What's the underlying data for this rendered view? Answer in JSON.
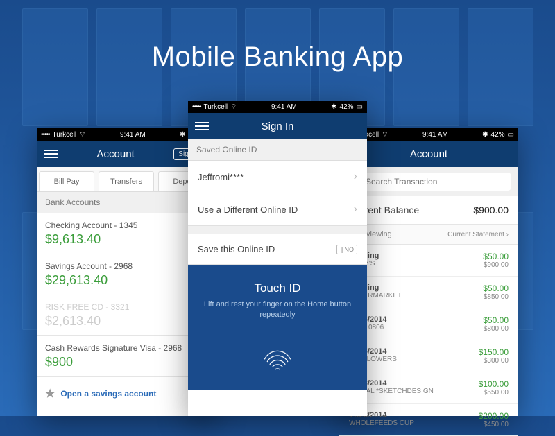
{
  "hero": {
    "title": "Mobile Banking App"
  },
  "status": {
    "carrier": "Turkcell",
    "time": "9:41 AM",
    "battery": "42%"
  },
  "navs": {
    "account": "Account",
    "signin": "Sign In",
    "signout": "Sign out"
  },
  "tabs": {
    "bill": "Bill Pay",
    "transfers": "Transfers",
    "deposit": "Deposit"
  },
  "accounts": {
    "header": "Bank Accounts",
    "items": [
      {
        "name": "Checking Account - 1345",
        "bal": "$9,613.40"
      },
      {
        "name": "Savings Account - 2968",
        "bal": "$29,613.40"
      },
      {
        "name": "RISK FREE CD - 3321",
        "bal": "$2,613.40"
      },
      {
        "name": "Cash Rewards Signature Visa - 2968",
        "bal": "$900"
      }
    ],
    "promo": "Open a savings account"
  },
  "signin": {
    "saved_header": "Saved Online ID",
    "user": "Jeffromi****",
    "different": "Use a Different Online ID",
    "save_toggle": "Save this Online ID",
    "toggle_state": "NO",
    "touchid_title": "Touch ID",
    "touchid_sub": "Lift and rest your finger on the Home button repeatedly"
  },
  "detail": {
    "search_ph": "Search Transaction",
    "balance_label": "Current Balance",
    "balance_amt": "$900.00",
    "viewing_label": "Now viewing",
    "viewing_link": "Current Statement",
    "txns": [
      {
        "date": "Pending",
        "merc": "MACY'S",
        "amt": "$50.00",
        "bal": "$900.00"
      },
      {
        "date": "Pending",
        "merc": "SUPERMARKET",
        "amt": "$50.00",
        "bal": "$850.00"
      },
      {
        "date": "11/26/2014",
        "merc": "PABT 0806",
        "amt": "$50.00",
        "bal": "$800.00"
      },
      {
        "date": "11/26/2014",
        "merc": "800 FLOWERS",
        "amt": "$150.00",
        "bal": "$300.00"
      },
      {
        "date": "11/23/2014",
        "merc": "PAYPAL *SKETCHDESIGN",
        "amt": "$100.00",
        "bal": "$550.00"
      },
      {
        "date": "11/23/2014",
        "merc": "WHOLEFEEDS CUP",
        "amt": "$200.00",
        "bal": "$450.00"
      }
    ]
  }
}
